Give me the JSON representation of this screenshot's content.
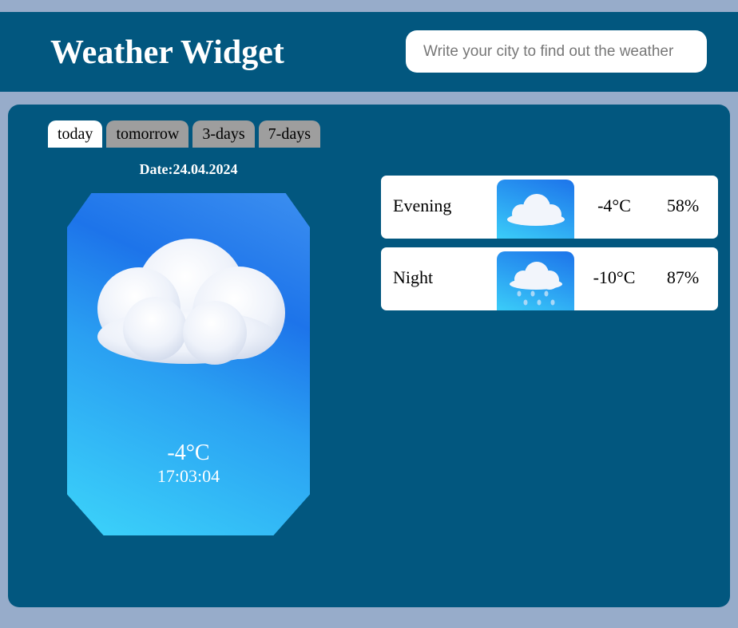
{
  "header": {
    "title": "Weather Widget",
    "search_placeholder": "Write your city to find out the weather"
  },
  "tabs": [
    {
      "label": "today",
      "active": true
    },
    {
      "label": "tomorrow",
      "active": false
    },
    {
      "label": "3-days",
      "active": false
    },
    {
      "label": "7-days",
      "active": false
    }
  ],
  "today": {
    "date": "Date:24.04.2024",
    "icon": "cloud-icon",
    "temperature": "-4°C",
    "time": "17:03:04"
  },
  "periods": [
    {
      "name": "Evening",
      "icon": "cloud-icon",
      "temperature": "-4°C",
      "humidity": "58%"
    },
    {
      "name": "Night",
      "icon": "rain-cloud-icon",
      "temperature": "-10°C",
      "humidity": "87%"
    }
  ],
  "colors": {
    "page_background": "#97acca",
    "panel_background": "#02577f",
    "active_tab": "#ffffff",
    "inactive_tab": "#9e9e9e",
    "card_gradient_light": "#3cd4fa",
    "card_gradient_dark": "#1d74ea"
  }
}
